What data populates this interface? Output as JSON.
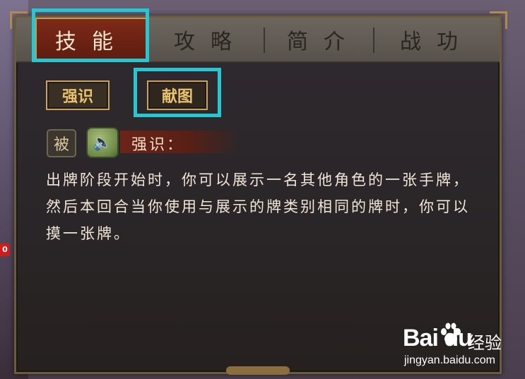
{
  "tabs": [
    {
      "label": "技能"
    },
    {
      "label": "攻略"
    },
    {
      "label": "简介"
    },
    {
      "label": "战功"
    }
  ],
  "skill_buttons": [
    {
      "label": "强识"
    },
    {
      "label": "献图"
    }
  ],
  "skill": {
    "type_badge": "被",
    "name": "强识：",
    "description": "出牌阶段开始时，你可以展示一名其他角色的一张手牌，然后本回合当你使用与展示的牌类别相同的牌时，你可以摸一张牌。"
  },
  "side_badge": "0",
  "watermark": {
    "logo": "Bai  du",
    "service": "经验",
    "url": "jingyan.baidu.com"
  },
  "colors": {
    "highlight": "#26c6d2",
    "active_tab": "#7e2a18",
    "gold": "#c9a262"
  }
}
